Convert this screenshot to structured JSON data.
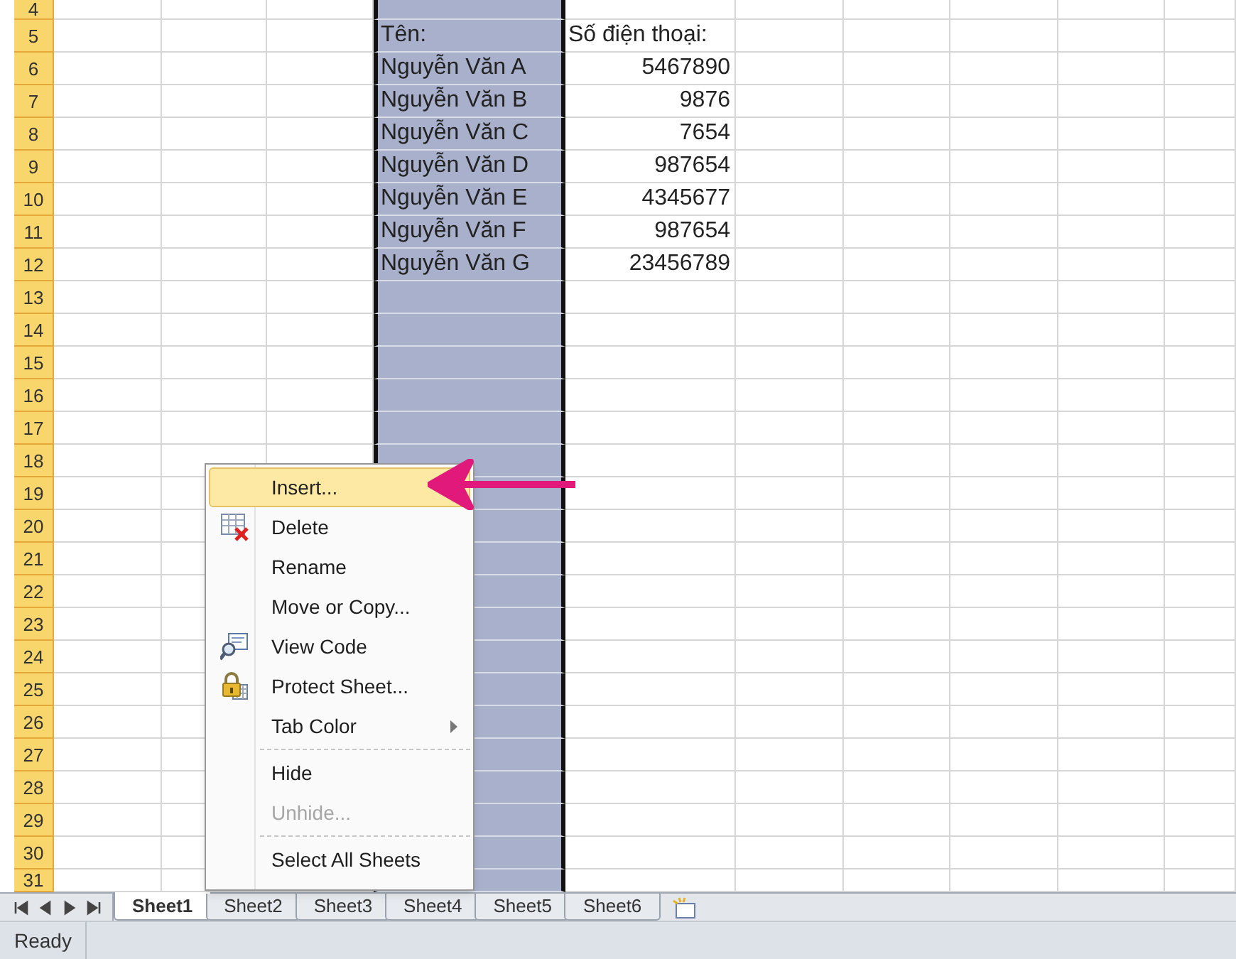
{
  "grid": {
    "row_headers": [
      "4",
      "5",
      "6",
      "7",
      "8",
      "9",
      "10",
      "11",
      "12",
      "13",
      "14",
      "15",
      "16",
      "17",
      "18",
      "19",
      "20",
      "21",
      "22",
      "23",
      "24",
      "25",
      "26",
      "27",
      "28",
      "29",
      "30",
      "31"
    ],
    "columns": [
      {
        "selected": false
      },
      {
        "selected": false
      },
      {
        "selected": false
      },
      {
        "selected": true
      },
      {
        "selected": false
      },
      {
        "selected": false
      },
      {
        "selected": false
      },
      {
        "selected": false
      },
      {
        "selected": false
      },
      {
        "selected": false
      }
    ],
    "name_header": "Tên:",
    "phone_header": "Số điện thoại:",
    "records": [
      {
        "name": "Nguyễn Văn A",
        "phone": "5467890"
      },
      {
        "name": "Nguyễn Văn B",
        "phone": "9876"
      },
      {
        "name": "Nguyễn Văn C",
        "phone": "7654"
      },
      {
        "name": "Nguyễn Văn D",
        "phone": "987654"
      },
      {
        "name": "Nguyễn Văn E",
        "phone": "4345677"
      },
      {
        "name": "Nguyễn Văn F",
        "phone": "987654"
      },
      {
        "name": "Nguyễn Văn G",
        "phone": "23456789"
      }
    ]
  },
  "context_menu": {
    "items": [
      {
        "label": "Insert...",
        "selected": true,
        "disabled": false,
        "submenu": false,
        "separator_before": false
      },
      {
        "label": "Delete",
        "selected": false,
        "disabled": false,
        "submenu": false,
        "separator_before": false
      },
      {
        "label": "Rename",
        "selected": false,
        "disabled": false,
        "submenu": false,
        "separator_before": false
      },
      {
        "label": "Move or Copy...",
        "selected": false,
        "disabled": false,
        "submenu": false,
        "separator_before": false
      },
      {
        "label": "View Code",
        "selected": false,
        "disabled": false,
        "submenu": false,
        "separator_before": false
      },
      {
        "label": "Protect Sheet...",
        "selected": false,
        "disabled": false,
        "submenu": false,
        "separator_before": false
      },
      {
        "label": "Tab Color",
        "selected": false,
        "disabled": false,
        "submenu": true,
        "separator_before": false
      },
      {
        "label": "Hide",
        "selected": false,
        "disabled": false,
        "submenu": false,
        "separator_before": true
      },
      {
        "label": "Unhide...",
        "selected": false,
        "disabled": true,
        "submenu": false,
        "separator_before": false
      },
      {
        "label": "Select All Sheets",
        "selected": false,
        "disabled": false,
        "submenu": false,
        "separator_before": true
      }
    ]
  },
  "sheet_tabs": [
    {
      "label": "Sheet1",
      "selected": true
    },
    {
      "label": "Sheet2",
      "selected": false
    },
    {
      "label": "Sheet3",
      "selected": false
    },
    {
      "label": "Sheet4",
      "selected": false
    },
    {
      "label": "Sheet5",
      "selected": false
    },
    {
      "label": "Sheet6",
      "selected": false
    }
  ],
  "status_bar": {
    "text": "Ready"
  }
}
